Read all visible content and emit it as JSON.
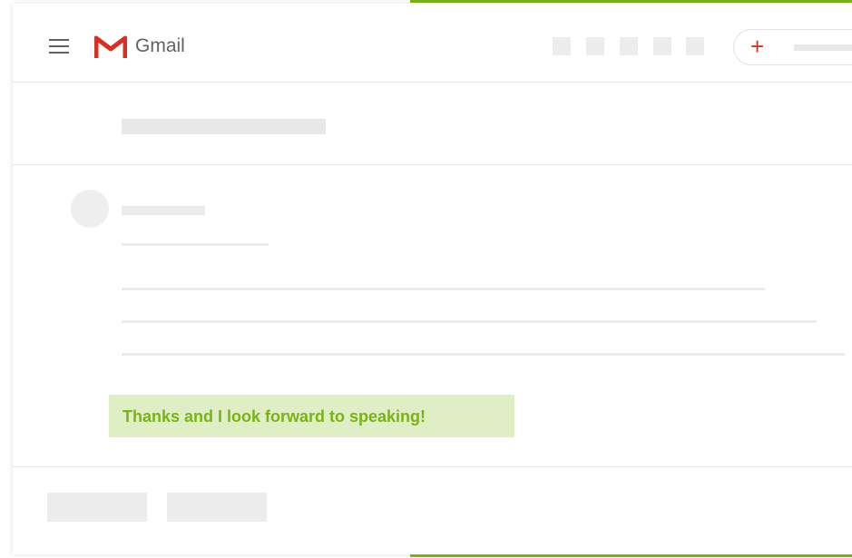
{
  "app": {
    "name": "Gmail",
    "logo_icon": "gmail-m-logo",
    "menu_icon": "hamburger-menu-icon"
  },
  "toolbar": {
    "compose_icon": "plus-icon",
    "compose_symbol": "+"
  },
  "message": {
    "highlighted_text": "Thanks and I look forward to speaking!"
  },
  "colors": {
    "accent": "#7ab317",
    "highlight_bg": "#dfeec5",
    "gmail_red": "#d93025",
    "skeleton": "#ebebeb",
    "text_grey": "#5f6368"
  }
}
